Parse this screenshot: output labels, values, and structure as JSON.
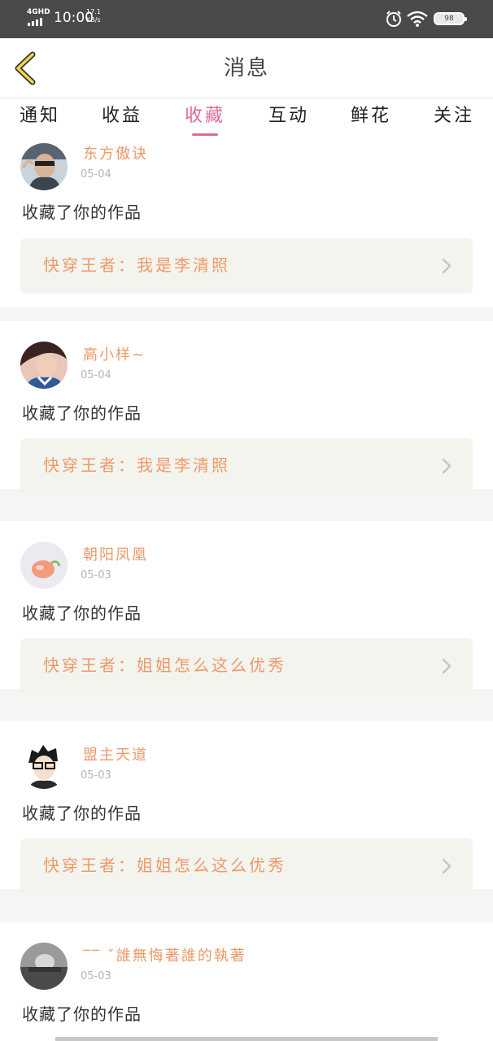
{
  "status_bar": {
    "network": "4GHD",
    "time": "10:00",
    "speed_value": "17.1",
    "speed_unit": "KB/s",
    "battery": "98",
    "icons": [
      "signal-icon",
      "alarm-icon",
      "wifi-icon",
      "battery-icon"
    ]
  },
  "header": {
    "back_icon": "chevron-left-icon",
    "title": "消息"
  },
  "tabs": [
    {
      "label": "通知",
      "active": false
    },
    {
      "label": "收益",
      "active": false
    },
    {
      "label": "收藏",
      "active": true
    },
    {
      "label": "互动",
      "active": false
    },
    {
      "label": "鲜花",
      "active": false
    },
    {
      "label": "关注",
      "active": false
    }
  ],
  "colors": {
    "accent_pink": "#e06a9a",
    "name_orange": "#eb9a6a",
    "card_bg": "#f4f4ee",
    "status_bar": "#4a4a4a"
  },
  "messages": [
    {
      "name": "东方傲诀",
      "date": "05-04",
      "text": "收藏了你的作品",
      "work": "快穿王者：我是李清照"
    },
    {
      "name": "高小样~",
      "date": "05-04",
      "text": "收藏了你的作品",
      "work": "快穿王者：我是李清照"
    },
    {
      "name": "朝阳凤凰",
      "date": "05-03",
      "text": "收藏了你的作品",
      "work": "快穿王者：姐姐怎么这么优秀"
    },
    {
      "name": "盟主天道",
      "date": "05-03",
      "text": "收藏了你的作品",
      "work": "快穿王者：姐姐怎么这么优秀"
    },
    {
      "name": "‾‾ ˇ誰無悔著誰的執著",
      "date": "05-03",
      "text": "收藏了你的作品",
      "work": ""
    }
  ]
}
